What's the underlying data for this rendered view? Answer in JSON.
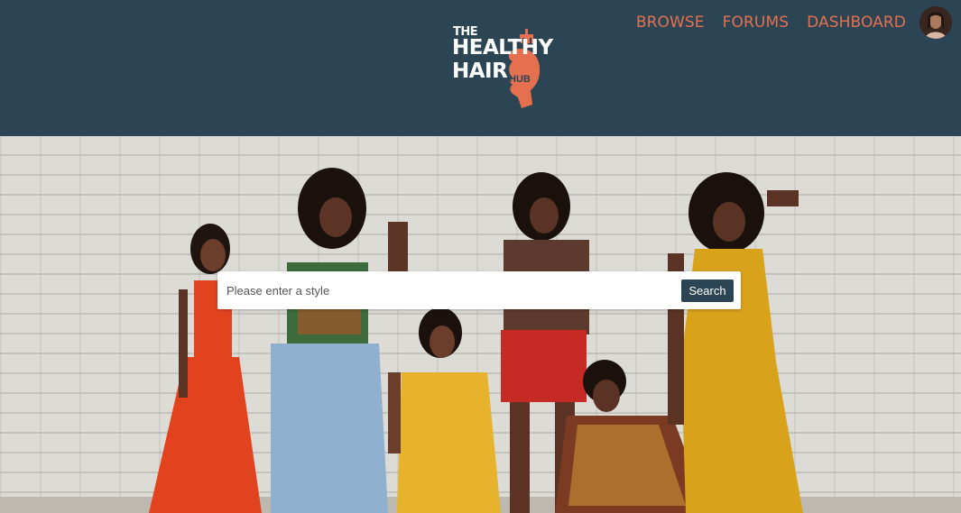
{
  "brand": {
    "line1": "THE",
    "line2": "HEALTHY",
    "line3": "HAIR",
    "line4": "HUB",
    "accent_color": "#e4704f",
    "header_color": "#2c4555"
  },
  "nav": {
    "browse": "BROWSE",
    "forums": "FORUMS",
    "dashboard": "DASHBOARD"
  },
  "user": {
    "avatar_icon": "user-avatar-photo"
  },
  "hero": {
    "image_description": "group-photo"
  },
  "search": {
    "placeholder": "Please enter a style",
    "value": "",
    "button_label": "Search"
  }
}
